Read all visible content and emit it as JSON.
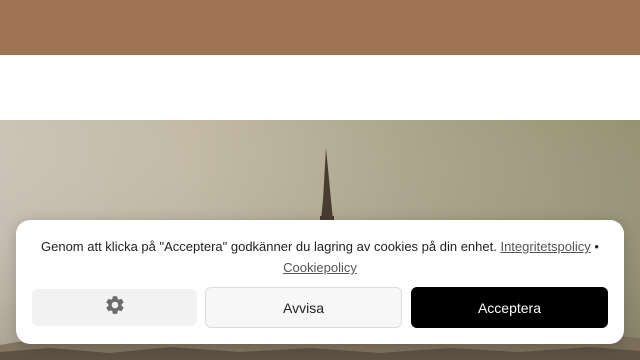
{
  "cookie_banner": {
    "message": "Genom att klicka på \"Acceptera\" godkänner du lagring av cookies på din enhet.",
    "privacy_link": "Integritetspolicy",
    "separator": "•",
    "cookie_link": "Cookiepolicy",
    "preferences_icon": "gear-icon",
    "deny_label": "Avvisa",
    "accept_label": "Acceptera"
  },
  "colors": {
    "header_band": "#9e7454",
    "accept_button": "#000000",
    "banner_background": "#ffffff"
  }
}
